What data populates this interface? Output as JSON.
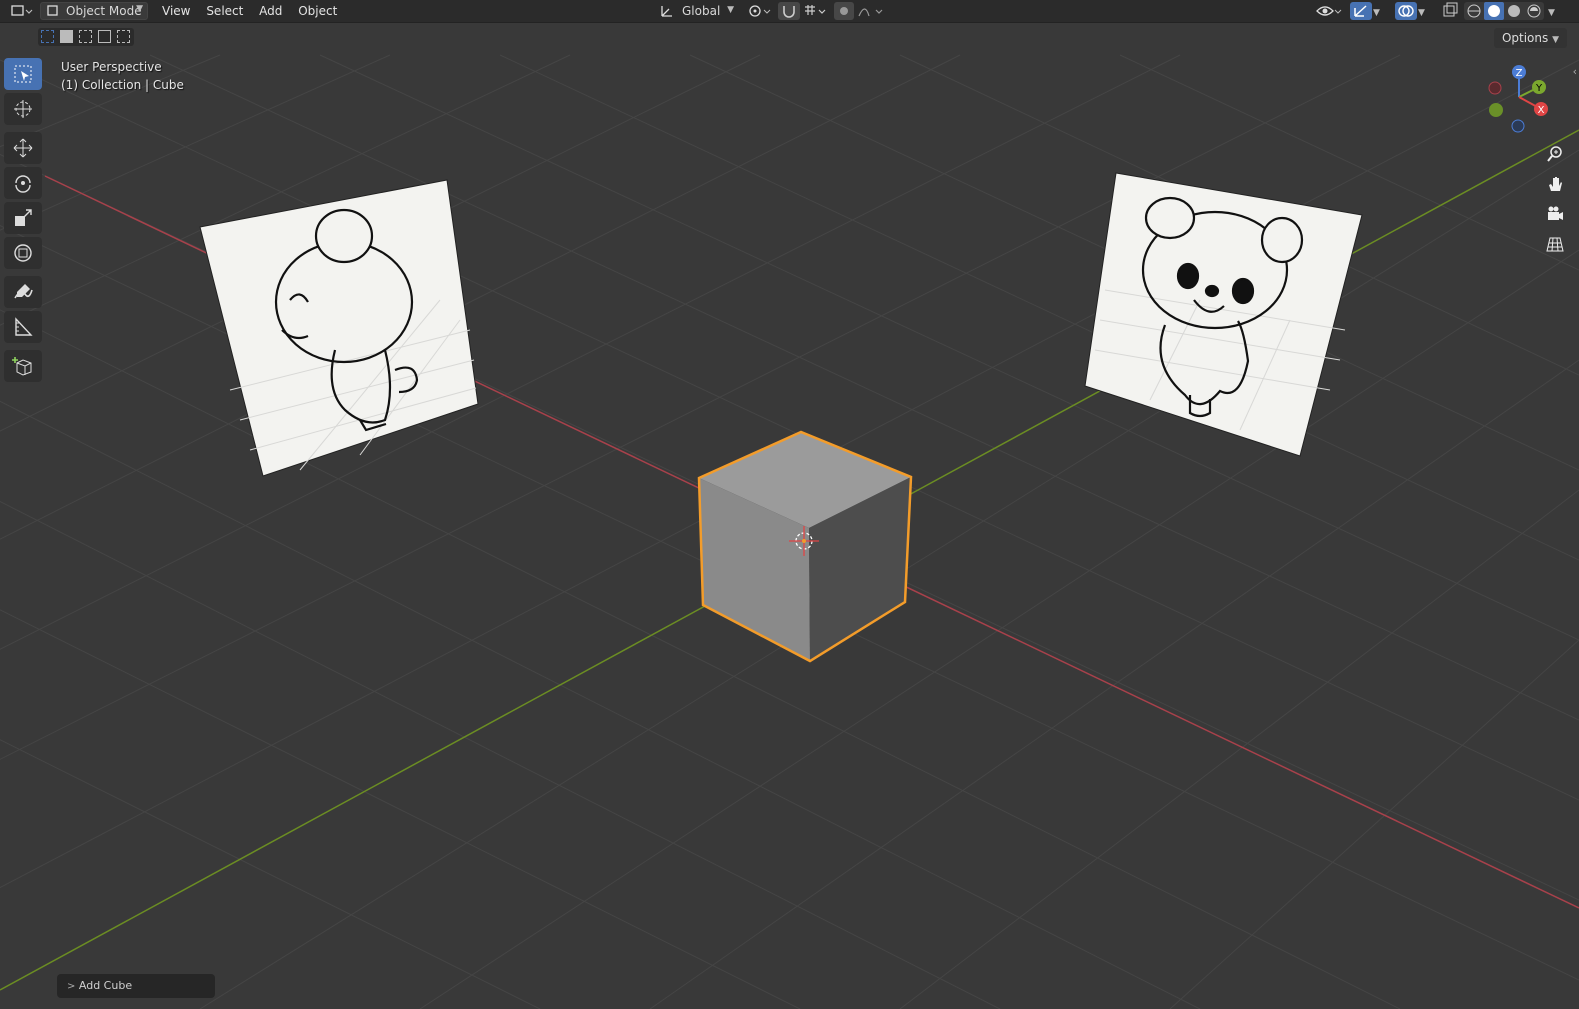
{
  "header": {
    "mode_label": "Object Mode",
    "menus": [
      "View",
      "Select",
      "Add",
      "Object"
    ],
    "transform_orientation": "Global"
  },
  "toolbar_right": {
    "options_label": "Options"
  },
  "viewport": {
    "perspective_label": "User Perspective",
    "object_label": "(1) Collection | Cube"
  },
  "gizmo": {
    "x_label": "X",
    "y_label": "Y",
    "z_label": "Z"
  },
  "tools": [
    "select-box",
    "cursor",
    "move",
    "rotate",
    "scale",
    "transform",
    "annotate",
    "measure",
    "add-cube"
  ],
  "nav_buttons": [
    "zoom",
    "pan",
    "camera",
    "ortho-toggle"
  ],
  "last_operator": {
    "label": "Add Cube"
  },
  "colors": {
    "bg": "#393939",
    "grid": "#4a4a4a",
    "x_axis": "#a8414b",
    "y_axis": "#6b8d23",
    "selection": "#f39c2a",
    "accent": "#4772b3"
  }
}
